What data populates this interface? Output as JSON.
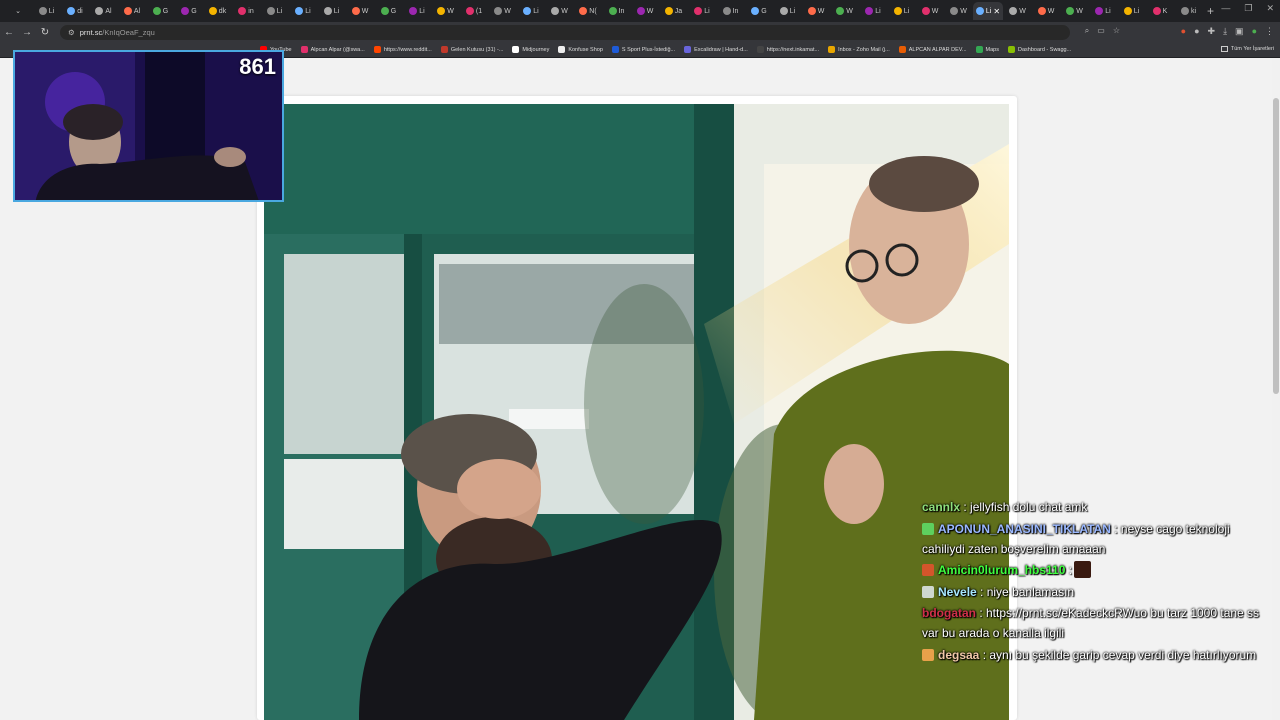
{
  "browser": {
    "tabs": [
      "Li",
      "di",
      "Al",
      "Al",
      "G",
      "G",
      "dk",
      "in",
      "Li",
      "Li",
      "Li",
      "W",
      "G",
      "Li",
      "W",
      "(1",
      "W",
      "Li",
      "W",
      "N(",
      "In",
      "W",
      "Ja",
      "Li",
      "In",
      "G",
      "Li",
      "W",
      "W",
      "Li",
      "Li",
      "W",
      "W",
      "Li",
      "W",
      "W",
      "W",
      "Li",
      "Li",
      "K",
      "ki"
    ],
    "active_tab": "Li",
    "url_host": "prnt.sc",
    "url_path": "/KnIqOeaF_zqu",
    "new_tab_icon": "plus-icon",
    "bookmarks": [
      {
        "label": "YouTube",
        "color": "#ff0000"
      },
      {
        "label": "Alpcan Alpar (@swa...",
        "color": "#e1306c"
      },
      {
        "label": "https://www.reddit...",
        "color": "#ff4500"
      },
      {
        "label": "Gelen Kutusu (31) -...",
        "color": "#c0392b"
      },
      {
        "label": "Midjourney",
        "color": "#ffffff"
      },
      {
        "label": "Konfuse Shop",
        "color": "#eeeeee"
      },
      {
        "label": "S Sport Plus-İstediğ...",
        "color": "#1e5bd8"
      },
      {
        "label": "Excalidraw | Hand-d...",
        "color": "#6965db"
      },
      {
        "label": "https://next.inkamat...",
        "color": "#444444"
      },
      {
        "label": "Inbox - Zoho Mail (j...",
        "color": "#e8a600"
      },
      {
        "label": "ALPCAN ALPAR DEV...",
        "color": "#e85d04"
      },
      {
        "label": "Maps",
        "color": "#34a853"
      },
      {
        "label": "Dashboard - Swagg...",
        "color": "#89bf04"
      }
    ],
    "all_bookmarks": "Tüm Yer İşaretleri"
  },
  "overlay": {
    "counter": "861"
  },
  "chat": [
    {
      "user": "cannlx",
      "user_color": "#8fe07c",
      "badge": "",
      "text": ": jellyfish dolu chat amk",
      "text_color": "#ffffff",
      "emote": false
    },
    {
      "user": "APONUN_ANASINI_TIKLATAN",
      "user_color": "#9ab8ff",
      "badge": "#5ed05e",
      "text": ": neyse cago teknoloji cahiliydi zaten boşverelim amaaan",
      "text_color": "#ffffff",
      "emote": false
    },
    {
      "user": "Amicin0lurum_hbs110",
      "user_color": "#3fff3f",
      "badge": "#d4552b",
      "text": ":",
      "text_color": "#ffffff",
      "emote": true
    },
    {
      "user": "Nevele",
      "user_color": "#a8e8ff",
      "badge": "#cfd8cf",
      "text": ": niye banlamasın",
      "text_color": "#ffffff",
      "emote": false
    },
    {
      "user": "bdogatan",
      "user_color": "#d0304a",
      "badge": "",
      "text": ": https://prnt.sc/eKadeckcRWuo bu tarz 1000 tane ss var bu arada o kanalla ilgili",
      "text_color": "#ffffff",
      "emote": false
    },
    {
      "user": "degsaa",
      "user_color": "#f0c8a8",
      "badge": "#e8a14a",
      "text": ": aynı bu şekilde garip cevap verdi diye hatırlıyorum",
      "text_color": "#ffffff",
      "emote": false
    }
  ]
}
